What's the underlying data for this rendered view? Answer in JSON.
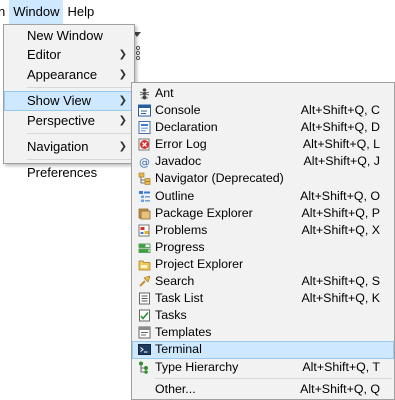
{
  "menubar": {
    "items": [
      {
        "label": "n",
        "active": false
      },
      {
        "label": "Window",
        "active": true
      },
      {
        "label": "Help",
        "active": false
      }
    ]
  },
  "window_menu": {
    "items": [
      {
        "label": "New Window",
        "has_submenu": false
      },
      {
        "label": "Editor",
        "has_submenu": true
      },
      {
        "label": "Appearance",
        "has_submenu": true
      },
      {
        "label": "Show View",
        "has_submenu": true,
        "highlighted": true
      },
      {
        "label": "Perspective",
        "has_submenu": true
      },
      {
        "label": "Navigation",
        "has_submenu": true
      },
      {
        "label": "Preferences",
        "has_submenu": false
      }
    ]
  },
  "show_view_menu": {
    "items": [
      {
        "label": "Ant",
        "shortcut": "",
        "icon": "ant-icon"
      },
      {
        "label": "Console",
        "shortcut": "Alt+Shift+Q, C",
        "icon": "console-icon"
      },
      {
        "label": "Declaration",
        "shortcut": "Alt+Shift+Q, D",
        "icon": "declaration-icon"
      },
      {
        "label": "Error Log",
        "shortcut": "Alt+Shift+Q, L",
        "icon": "error-log-icon"
      },
      {
        "label": "Javadoc",
        "shortcut": "Alt+Shift+Q, J",
        "icon": "javadoc-icon"
      },
      {
        "label": "Navigator (Deprecated)",
        "shortcut": "",
        "icon": "navigator-icon"
      },
      {
        "label": "Outline",
        "shortcut": "Alt+Shift+Q, O",
        "icon": "outline-icon"
      },
      {
        "label": "Package Explorer",
        "shortcut": "Alt+Shift+Q, P",
        "icon": "package-explorer-icon"
      },
      {
        "label": "Problems",
        "shortcut": "Alt+Shift+Q, X",
        "icon": "problems-icon"
      },
      {
        "label": "Progress",
        "shortcut": "",
        "icon": "progress-icon"
      },
      {
        "label": "Project Explorer",
        "shortcut": "",
        "icon": "project-explorer-icon"
      },
      {
        "label": "Search",
        "shortcut": "Alt+Shift+Q, S",
        "icon": "search-icon"
      },
      {
        "label": "Task List",
        "shortcut": "Alt+Shift+Q, K",
        "icon": "task-list-icon"
      },
      {
        "label": "Tasks",
        "shortcut": "",
        "icon": "tasks-icon"
      },
      {
        "label": "Templates",
        "shortcut": "",
        "icon": "templates-icon"
      },
      {
        "label": "Terminal",
        "shortcut": "",
        "icon": "terminal-icon",
        "highlighted": true
      },
      {
        "label": "Type Hierarchy",
        "shortcut": "Alt+Shift+Q, T",
        "icon": "type-hierarchy-icon"
      },
      {
        "label": "Other...",
        "shortcut": "Alt+Shift+Q, Q",
        "icon": ""
      }
    ]
  },
  "colors": {
    "highlight": "#cde8ff",
    "highlight_border": "#99c9ef",
    "menu_bg": "#f2f2f2"
  }
}
